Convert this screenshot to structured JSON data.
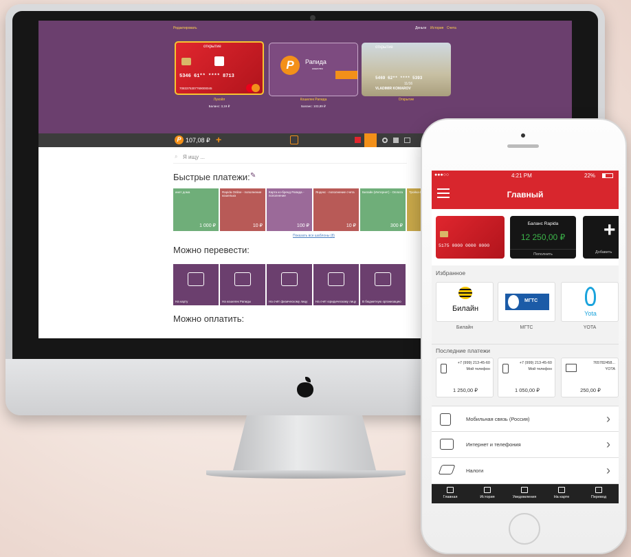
{
  "desktop": {
    "top_links": {
      "edit": "Редактировать",
      "money": "Деньги",
      "history": "История",
      "accounts": "Счета"
    },
    "cards": [
      {
        "brand": "открытие",
        "number": "5346  61**  ****  8713",
        "account": "7083375307769000045",
        "label": "Лукойл",
        "balance": "Баланс: 3,19 ₽"
      },
      {
        "brand": "Рапида",
        "sub": "кошелек",
        "label": "Кошелек Рапида",
        "balance": "Баланс: 103,89 ₽"
      },
      {
        "brand": "открытие",
        "number": "5469  62**  ****  5393",
        "expiry": "11/16",
        "holder": "VLADIMIR KOMAROV",
        "label": "Открытие",
        "balance": ""
      }
    ],
    "navbar": {
      "balance": "107,08 ₽",
      "plus": "+"
    },
    "search_placeholder": "Я ищу ...",
    "quick_payments_title": "Быстрые платежи:",
    "quick_tiles": [
      {
        "label": "инет дома",
        "amount": "1 000 ₽",
        "color": "#6fae79"
      },
      {
        "label": "Rapida Online - пополнение кошелька",
        "amount": "10 ₽",
        "color": "#b85a57"
      },
      {
        "label": "Карта ко-бренд Рапида - пополнение",
        "amount": "100 ₽",
        "color": "#9b6a99"
      },
      {
        "label": "Яндекс - пополнение счета",
        "amount": "10 ₽",
        "color": "#b85a57"
      },
      {
        "label": "Билайн (Интернет) - Оплата",
        "amount": "300 ₽",
        "color": "#6fae79"
      },
      {
        "label": "Тройка-Ва...",
        "amount": "",
        "color": "#c9a84a"
      }
    ],
    "show_all": "Показать все шаблоны (8)",
    "transfer_title": "Можно перевести:",
    "transfer_tiles": [
      {
        "label": "На карту"
      },
      {
        "label": "На кошелек Рапиды"
      },
      {
        "label": "На счёт физическому лицу"
      },
      {
        "label": "На счёт юридическому лицу"
      },
      {
        "label": "В бюджетную организацию"
      }
    ],
    "pay_title": "Можно оплатить:"
  },
  "phone": {
    "status": {
      "carrier": "●●●○○",
      "time": "4:21 PM",
      "battery": "22%"
    },
    "title": "Главный",
    "card": {
      "number": "5175  0000  0000  0000"
    },
    "rapida": {
      "label": "Баланс Rapida",
      "amount": "12 250,00 ₽",
      "button": "Пополнить"
    },
    "add_label": "Добавить",
    "favorites_title": "Избранное",
    "favorites": [
      {
        "logo_text": "Билайн",
        "label": "Билайн"
      },
      {
        "logo_text": "МГТС",
        "label": "МГТС"
      },
      {
        "logo_text": "Yota",
        "label": "YOTA"
      }
    ],
    "recent_title": "Последние платежи",
    "recent": [
      {
        "phone": "+7 (999) 213-45-60",
        "name": "Мой телефон",
        "amount": "1 250,00 ₽"
      },
      {
        "phone": "+7 (999) 213-45-60",
        "name": "Мой телефон",
        "amount": "1 050,00 ₽"
      },
      {
        "phone": "765782458...",
        "name": "YOTA",
        "amount": "250,00 ₽"
      }
    ],
    "categories": [
      {
        "label": "Мобильная связь (Россия)"
      },
      {
        "label": "Интернет и телефония"
      },
      {
        "label": "Налоги"
      }
    ],
    "tabs": [
      {
        "label": "Главная"
      },
      {
        "label": "История"
      },
      {
        "label": "Уведомления"
      },
      {
        "label": "На карте"
      },
      {
        "label": "Перевод"
      }
    ]
  }
}
